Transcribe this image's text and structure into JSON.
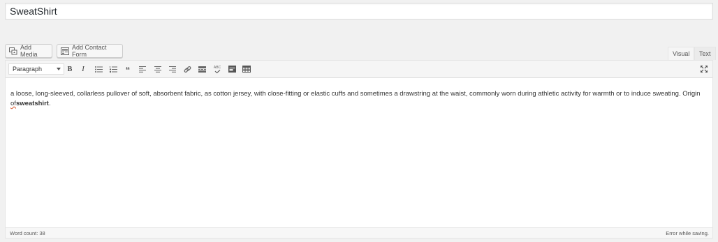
{
  "title_field": {
    "value": "SweatShirt"
  },
  "media_buttons": {
    "add_media": "Add Media",
    "add_contact_form": "Add Contact Form"
  },
  "editor_tabs": {
    "visual": "Visual",
    "text": "Text"
  },
  "toolbar": {
    "format_select": "Paragraph",
    "buttons": [
      "bold",
      "italic",
      "bulleted-list",
      "numbered-list",
      "blockquote",
      "align-left",
      "align-center",
      "align-right",
      "link",
      "read-more",
      "spellcheck",
      "toolbar-toggle",
      "table",
      "fullscreen"
    ],
    "spellcheck_label": "ABC"
  },
  "content": {
    "text_main": "a loose, long-sleeved, collarless pullover of soft, absorbent fabric, as cotton jersey, with close-fitting or elastic cuffs and sometimes a drawstring at the waist, commonly worn during athletic activity for warmth or to induce sweating. Origin ",
    "misspelled": "of",
    "bold_word": "sweatshirt",
    "text_end": "."
  },
  "status": {
    "word_count": "Word count: 38",
    "save_message": "Error while saving."
  }
}
